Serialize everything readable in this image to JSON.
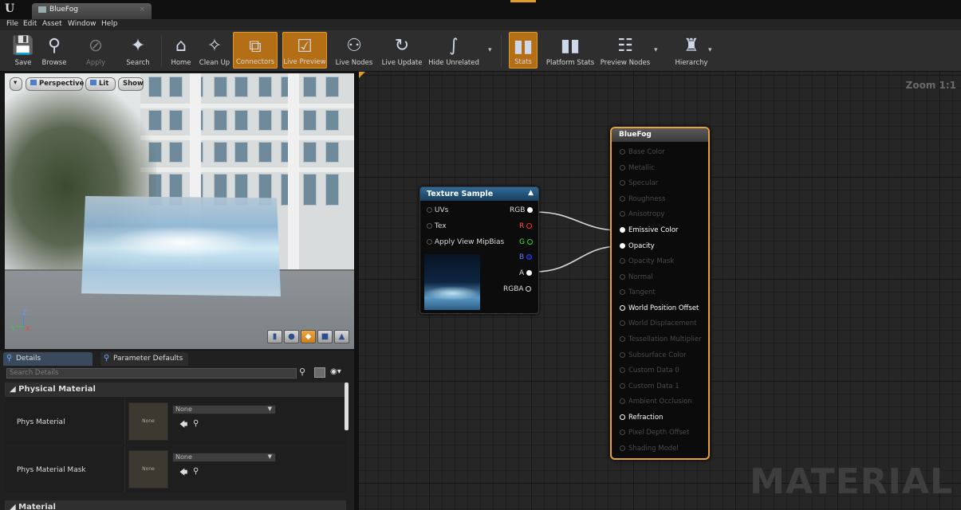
{
  "window": {
    "tab_title": "BlueFog"
  },
  "menu": [
    "File",
    "Edit",
    "Asset",
    "Window",
    "Help"
  ],
  "toolbar": {
    "save": "Save",
    "browse": "Browse",
    "apply": "Apply",
    "search": "Search",
    "home": "Home",
    "clean_up": "Clean Up",
    "connectors": "Connectors",
    "live_preview": "Live Preview",
    "live_nodes": "Live Nodes",
    "live_update": "Live Update",
    "hide_unrelated": "Hide Unrelated",
    "stats": "Stats",
    "platform_stats": "Platform Stats",
    "preview_nodes": "Preview Nodes",
    "hierarchy": "Hierarchy"
  },
  "viewport": {
    "perspective": "Perspective",
    "lit": "Lit",
    "show": "Show",
    "axis_z": "Z",
    "axis_y": "Y",
    "axis_x": "X"
  },
  "details": {
    "tab_details": "Details",
    "tab_params": "Parameter Defaults",
    "search_placeholder": "Search Details",
    "section_physical": "Physical Material",
    "phys_material": "Phys Material",
    "phys_material_value": "None",
    "phys_material_thumb": "None",
    "phys_material_mask": "Phys Material Mask",
    "phys_material_mask_value": "None",
    "phys_material_mask_thumb": "None",
    "section_material": "Material"
  },
  "graph": {
    "zoom": "Zoom 1:1",
    "watermark": "MATERIAL"
  },
  "texture_node": {
    "title": "Texture Sample",
    "inputs": [
      "UVs",
      "Tex",
      "Apply View MipBias"
    ],
    "outputs": [
      "RGB",
      "R",
      "G",
      "B",
      "A",
      "RGBA"
    ]
  },
  "material_node": {
    "title": "BlueFog",
    "pins": [
      "Base Color",
      "Metallic",
      "Specular",
      "Roughness",
      "Anisotropy",
      "Emissive Color",
      "Opacity",
      "Opacity Mask",
      "Normal",
      "Tangent",
      "World Position Offset",
      "World Displacement",
      "Tessellation Multiplier",
      "Subsurface Color",
      "Custom Data 0",
      "Custom Data 1",
      "Ambient Occlusion",
      "Refraction",
      "Pixel Depth Offset",
      "Shading Model"
    ]
  },
  "colors": {
    "accent": "#e09a2a",
    "node_header": "#2d6a99",
    "red": "#ff2a2a",
    "green": "#22dd22",
    "blue": "#2b3cff"
  }
}
